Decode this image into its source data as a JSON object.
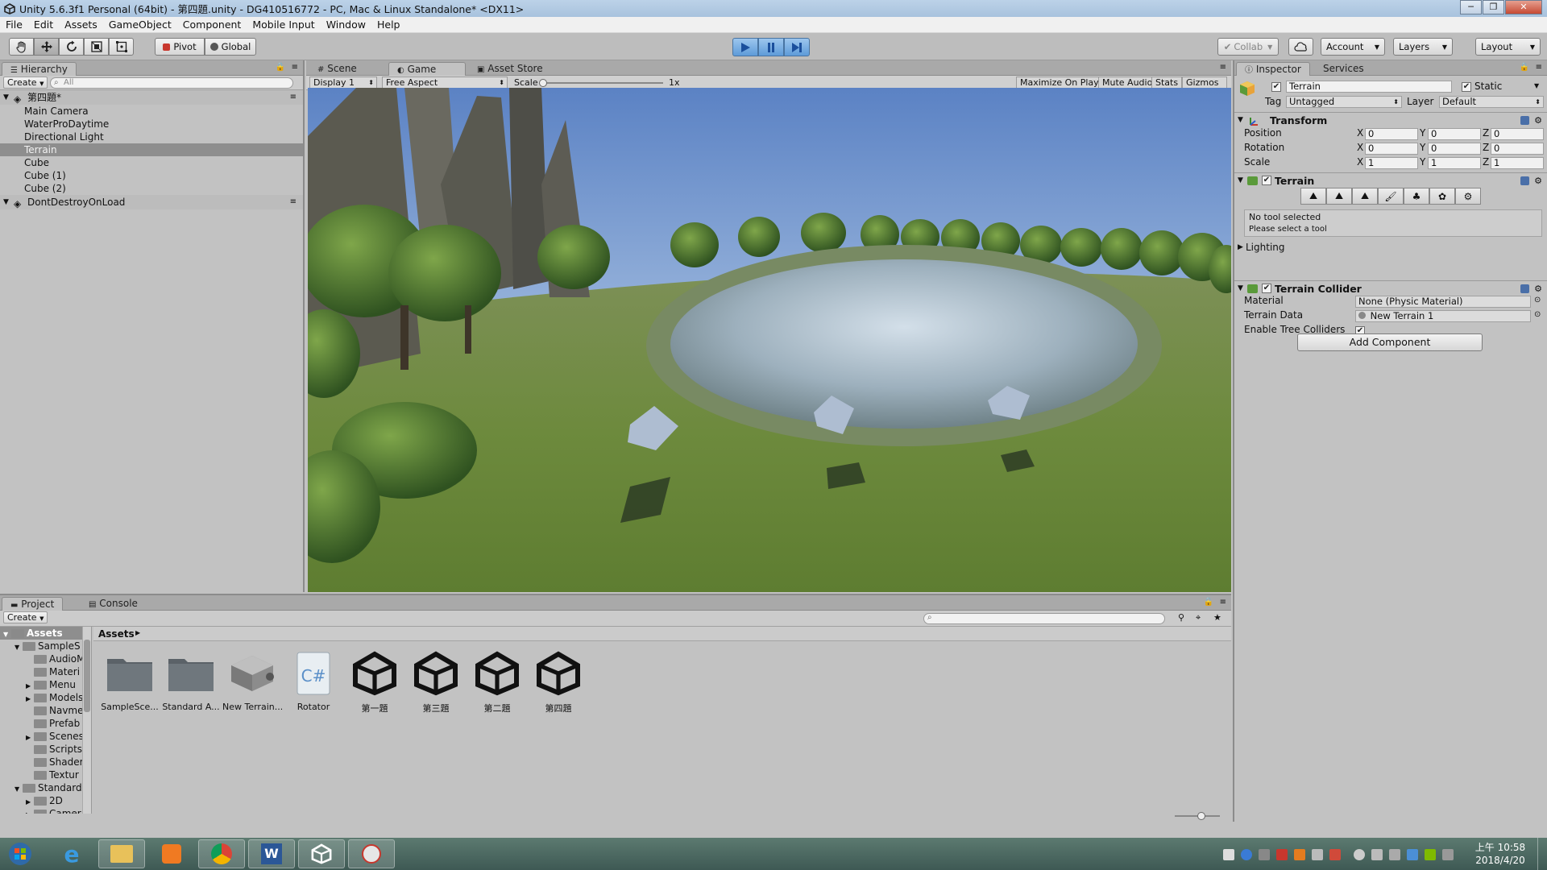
{
  "window": {
    "title": "Unity 5.6.3f1 Personal (64bit) - 第四題.unity - DG410516772 - PC, Mac & Linux Standalone* <DX11>",
    "buttons": {
      "min": "─",
      "max": "❐",
      "close": "✕"
    }
  },
  "menu": [
    "File",
    "Edit",
    "Assets",
    "GameObject",
    "Component",
    "Mobile Input",
    "Window",
    "Help"
  ],
  "toolbar": {
    "pivot": "Pivot",
    "global": "Global",
    "collab": "Collab",
    "account": "Account",
    "layers": "Layers",
    "layout": "Layout"
  },
  "hierarchy": {
    "tab": "Hierarchy",
    "create": "Create",
    "search_placeholder": "All",
    "scene": "第四題*",
    "items": [
      "Main Camera",
      "WaterProDaytime",
      "Directional Light",
      "Terrain",
      "Cube",
      "Cube (1)",
      "Cube (2)"
    ],
    "selected": "Terrain",
    "dont_destroy": "DontDestroyOnLoad"
  },
  "game_view": {
    "tabs": [
      "Scene",
      "Game",
      "Asset Store"
    ],
    "active_tab": "Game",
    "display": "Display 1",
    "aspect": "Free Aspect",
    "scale_label": "Scale",
    "scale_value": "1x",
    "options": [
      "Maximize On Play",
      "Mute Audio",
      "Stats",
      "Gizmos"
    ]
  },
  "inspector": {
    "tabs": [
      "Inspector",
      "Services"
    ],
    "object_name": "Terrain",
    "static_label": "Static",
    "tag_label": "Tag",
    "tag_value": "Untagged",
    "layer_label": "Layer",
    "layer_value": "Default",
    "transform": {
      "title": "Transform",
      "position_label": "Position",
      "rotation_label": "Rotation",
      "scale_label": "Scale",
      "position": [
        "0",
        "0",
        "0"
      ],
      "rotation": [
        "0",
        "0",
        "0"
      ],
      "scale": [
        "1",
        "1",
        "1"
      ]
    },
    "terrain": {
      "title": "Terrain",
      "no_tool": "No tool selected",
      "please_select": "Please select a tool",
      "lighting": "Lighting"
    },
    "terrain_collider": {
      "title": "Terrain Collider",
      "material_label": "Material",
      "material_value": "None (Physic Material)",
      "data_label": "Terrain Data",
      "data_value": "New Terrain 1",
      "trees_label": "Enable Tree Colliders"
    },
    "add_component": "Add Component"
  },
  "project": {
    "tabs": [
      "Project",
      "Console"
    ],
    "create": "Create",
    "breadcrumb": "Assets",
    "tree": [
      {
        "label": "Assets",
        "indent": 0,
        "arrow": "▼",
        "bold": true
      },
      {
        "label": "SampleS",
        "indent": 1,
        "arrow": "▼"
      },
      {
        "label": "AudioM",
        "indent": 2,
        "arrow": ""
      },
      {
        "label": "Materi",
        "indent": 2,
        "arrow": ""
      },
      {
        "label": "Menu",
        "indent": 2,
        "arrow": "▶"
      },
      {
        "label": "Models",
        "indent": 2,
        "arrow": "▶"
      },
      {
        "label": "Navme",
        "indent": 2,
        "arrow": ""
      },
      {
        "label": "Prefab",
        "indent": 2,
        "arrow": ""
      },
      {
        "label": "Scenes",
        "indent": 2,
        "arrow": "▶"
      },
      {
        "label": "Scripts",
        "indent": 2,
        "arrow": ""
      },
      {
        "label": "Shader",
        "indent": 2,
        "arrow": ""
      },
      {
        "label": "Textur",
        "indent": 2,
        "arrow": ""
      },
      {
        "label": "Standard",
        "indent": 1,
        "arrow": "▼"
      },
      {
        "label": "2D",
        "indent": 2,
        "arrow": "▶"
      },
      {
        "label": "Camer",
        "indent": 2,
        "arrow": "▶"
      }
    ],
    "assets": [
      {
        "label": "SampleSce...",
        "type": "folder"
      },
      {
        "label": "Standard A...",
        "type": "folder"
      },
      {
        "label": "New Terrain...",
        "type": "terrain"
      },
      {
        "label": "Rotator",
        "type": "script"
      },
      {
        "label": "第一題",
        "type": "unity"
      },
      {
        "label": "第三題",
        "type": "unity"
      },
      {
        "label": "第二題",
        "type": "unity"
      },
      {
        "label": "第四題",
        "type": "unity"
      }
    ]
  },
  "taskbar": {
    "time": "上午 10:58",
    "date": "2018/4/20"
  }
}
